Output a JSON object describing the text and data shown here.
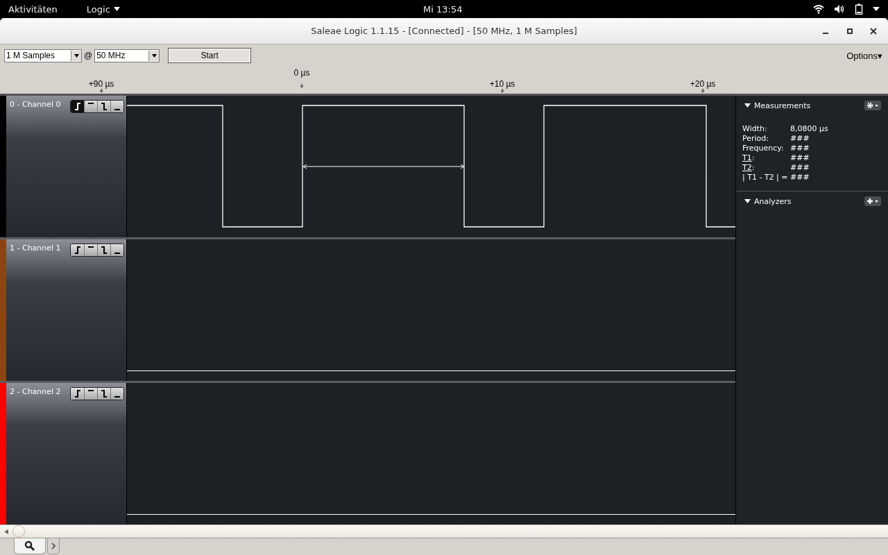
{
  "top_bar": {
    "activities": "Aktivitäten",
    "app_menu": "Logic",
    "clock": "Mi 13:54"
  },
  "window": {
    "title": "Saleae Logic 1.1.15 - [Connected] - [50 MHz, 1 M Samples]"
  },
  "toolbar": {
    "samples": "1 M Samples",
    "at": "@",
    "rate": "50 MHz",
    "start": "Start",
    "options": "Options▾"
  },
  "ruler": [
    {
      "label": "+90 µs",
      "kind": "tick"
    },
    {
      "label": "0 µs",
      "kind": "origin"
    },
    {
      "label": "+10 µs",
      "kind": "tick"
    },
    {
      "label": "+20 µs",
      "kind": "tick"
    }
  ],
  "channels": [
    {
      "name": "0 - Channel 0",
      "color": "#000000",
      "kind": "pulses",
      "triggers": [
        {
          "kind": "rising",
          "selected": true
        },
        {
          "kind": "high",
          "selected": false
        },
        {
          "kind": "falling",
          "selected": false
        },
        {
          "kind": "low",
          "selected": false
        }
      ]
    },
    {
      "name": "1 - Channel 1",
      "color": "#8b4513",
      "kind": "low",
      "triggers": [
        {
          "kind": "rising",
          "selected": false
        },
        {
          "kind": "high",
          "selected": false
        },
        {
          "kind": "falling",
          "selected": false
        },
        {
          "kind": "low",
          "selected": false
        }
      ]
    },
    {
      "name": "2 - Channel 2",
      "color": "#ff0000",
      "kind": "low",
      "triggers": [
        {
          "kind": "rising",
          "selected": false
        },
        {
          "kind": "high",
          "selected": false
        },
        {
          "kind": "falling",
          "selected": false
        },
        {
          "kind": "low",
          "selected": false
        }
      ]
    }
  ],
  "measurements": {
    "title": "Measurements",
    "expanded": true,
    "rows": [
      {
        "label": "Width:",
        "value": "8,0800 µs",
        "underline": false
      },
      {
        "label": "Period:",
        "value": "###",
        "underline": false
      },
      {
        "label": "Frequency:",
        "value": "###",
        "underline": false
      },
      {
        "label": "T1",
        "suffix": ":",
        "value": "###",
        "underline": true
      },
      {
        "label": "T2",
        "suffix": ":",
        "value": "###",
        "underline": true
      },
      {
        "label": "| T1 - T2 | =",
        "value": "###",
        "underline": false
      }
    ]
  },
  "analyzers": {
    "title": "Analyzers",
    "expanded": true
  }
}
